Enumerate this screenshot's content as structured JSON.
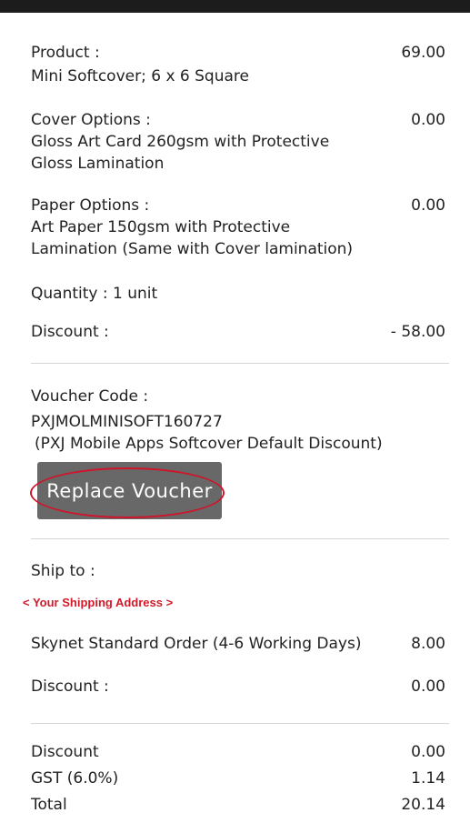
{
  "product": {
    "label": "Product :",
    "value": "Mini Softcover; 6 x 6 Square",
    "amount": "69.00"
  },
  "cover": {
    "label": "Cover Options :",
    "line1": "Gloss Art Card 260gsm with Protective",
    "line2": "Gloss Lamination",
    "amount": "0.00"
  },
  "paper": {
    "label": "Paper Options :",
    "line1": "Art Paper 150gsm with Protective",
    "line2": "Lamination (Same with Cover lamination)",
    "amount": "0.00"
  },
  "quantity": {
    "label": "Quantity : 1 unit"
  },
  "discount1": {
    "label": "Discount :",
    "amount": "- 58.00"
  },
  "voucher": {
    "label": "Voucher Code :",
    "code": "PXJMOLMINISOFT160727",
    "description": "(PXJ Mobile Apps Softcover Default Discount)",
    "button_label": "Replace Voucher"
  },
  "ship": {
    "label": "Ship to :",
    "address_placeholder": "< Your Shipping Address >"
  },
  "shipping": {
    "label": "Skynet Standard Order (4-6 Working Days)",
    "amount": "8.00"
  },
  "discount2": {
    "label": "Discount :",
    "amount": "0.00"
  },
  "summary": {
    "discount_label": "Discount",
    "discount_amount": "0.00",
    "gst_label": "GST (6.0%)",
    "gst_amount": "1.14",
    "total_label": "Total",
    "total_amount": "20.14"
  },
  "colors": {
    "topbar": "#1c1c1c",
    "button": "#686868",
    "highlight": "#d0142a",
    "address_text": "#d41a2a"
  }
}
